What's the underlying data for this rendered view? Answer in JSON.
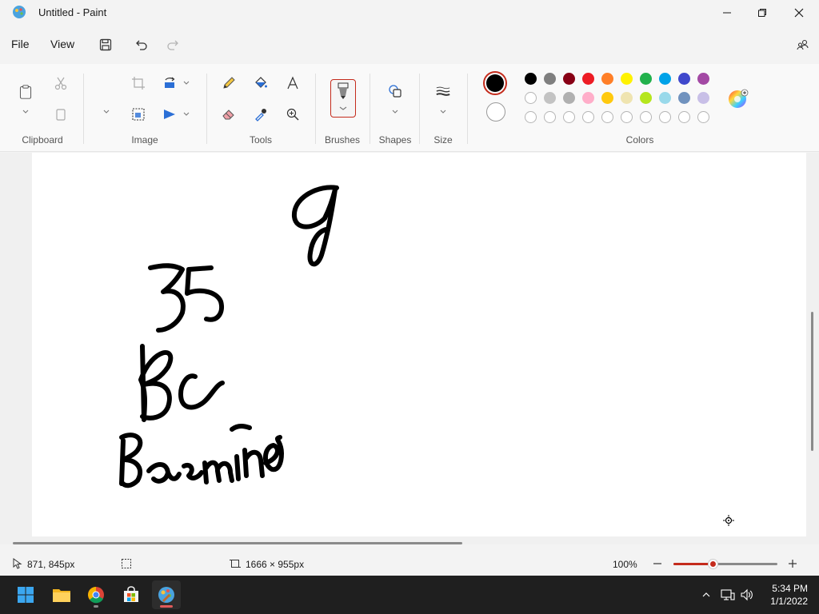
{
  "window": {
    "title": "Untitled - Paint"
  },
  "menu": {
    "file": "File",
    "view": "View"
  },
  "ribbon": {
    "groups": {
      "clipboard": "Clipboard",
      "image": "Image",
      "tools": "Tools",
      "brushes": "Brushes",
      "shapes": "Shapes",
      "size": "Size",
      "colors": "Colors"
    },
    "primary_color": "#000000",
    "secondary_color": "#ffffff",
    "palette_row1": [
      "#000000",
      "#7f7f7f",
      "#880015",
      "#ed1c24",
      "#ff7f27",
      "#fff200",
      "#22b14c",
      "#00a2e8",
      "#3f48cc",
      "#a349a4"
    ],
    "palette_row2": [
      "#ffffff",
      "#c3c3c3",
      "#b0b0b0",
      "#ffaec9",
      "#ffc90e",
      "#efe4b0",
      "#b5e61d",
      "#99d9ea",
      "#7092be",
      "#c8bfe7"
    ]
  },
  "canvas": {
    "handwriting": [
      "g",
      "35",
      "Bc",
      "Basmine"
    ]
  },
  "status": {
    "cursor_position": "871, 845px",
    "canvas_size": "1666 × 955px",
    "zoom": "100%"
  },
  "taskbar": {
    "time": "5:34 PM",
    "date": "1/1/2022"
  }
}
